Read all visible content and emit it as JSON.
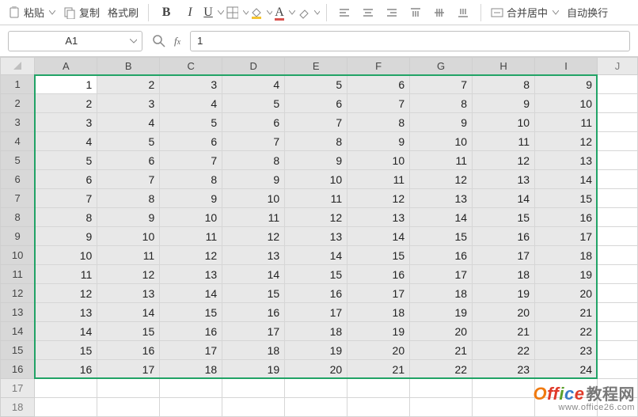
{
  "toolbar": {
    "paste": "粘贴",
    "copy": "复制",
    "format_painter": "格式刷",
    "merge_center": "合并居中",
    "auto_wrap": "自动换行"
  },
  "namebox": {
    "value": "A1"
  },
  "formula": {
    "value": "1"
  },
  "columns": [
    "A",
    "B",
    "C",
    "D",
    "E",
    "F",
    "G",
    "H",
    "I",
    "J"
  ],
  "watermark": {
    "brand": "Office教程网",
    "url": "www.office26.com"
  },
  "chart_data": {
    "type": "table",
    "rows": 18,
    "data_row_count": 16,
    "data_col_count": 9,
    "selection": "A1:I16",
    "active_cell": "A1",
    "cells": [
      [
        1,
        2,
        3,
        4,
        5,
        6,
        7,
        8,
        9
      ],
      [
        2,
        3,
        4,
        5,
        6,
        7,
        8,
        9,
        10
      ],
      [
        3,
        4,
        5,
        6,
        7,
        8,
        9,
        10,
        11
      ],
      [
        4,
        5,
        6,
        7,
        8,
        9,
        10,
        11,
        12
      ],
      [
        5,
        6,
        7,
        8,
        9,
        10,
        11,
        12,
        13
      ],
      [
        6,
        7,
        8,
        9,
        10,
        11,
        12,
        13,
        14
      ],
      [
        7,
        8,
        9,
        10,
        11,
        12,
        13,
        14,
        15
      ],
      [
        8,
        9,
        10,
        11,
        12,
        13,
        14,
        15,
        16
      ],
      [
        9,
        10,
        11,
        12,
        13,
        14,
        15,
        16,
        17
      ],
      [
        10,
        11,
        12,
        13,
        14,
        15,
        16,
        17,
        18
      ],
      [
        11,
        12,
        13,
        14,
        15,
        16,
        17,
        18,
        19
      ],
      [
        12,
        13,
        14,
        15,
        16,
        17,
        18,
        19,
        20
      ],
      [
        13,
        14,
        15,
        16,
        17,
        18,
        19,
        20,
        21
      ],
      [
        14,
        15,
        16,
        17,
        18,
        19,
        20,
        21,
        22
      ],
      [
        15,
        16,
        17,
        18,
        19,
        20,
        21,
        22,
        23
      ],
      [
        16,
        17,
        18,
        19,
        20,
        21,
        22,
        23,
        24
      ]
    ]
  }
}
